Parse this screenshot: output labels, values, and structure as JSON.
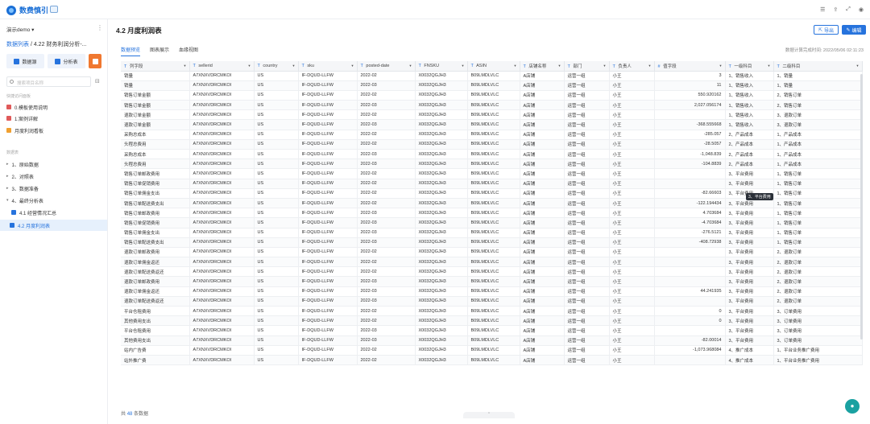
{
  "app": {
    "logo_text": "数费慎引"
  },
  "topbar": {
    "icons": [
      "list-icon",
      "share-icon",
      "expand-icon",
      "user-icon"
    ]
  },
  "sidebar": {
    "workspace": "演示demo",
    "breadcrumb_link": "数据列表",
    "breadcrumb_rest": " / 4.22 财务利润分析-...",
    "buttons": [
      {
        "label": "数据源"
      },
      {
        "label": "分析表"
      }
    ],
    "search_placeholder": "搜索项目名称",
    "section_recent": "快捷访问面板",
    "recent": [
      {
        "label": "0.模板使用说明"
      },
      {
        "label": "1.案例详解"
      },
      {
        "label": "月度利润看板"
      }
    ],
    "section_tables": "数据表",
    "folders": [
      {
        "label": "1、原始数据"
      },
      {
        "label": "2、对照表"
      },
      {
        "label": "3、数据准备"
      },
      {
        "label": "4、最终分析表"
      }
    ],
    "subitems": [
      {
        "label": "4.1 经营情况汇总"
      },
      {
        "label": "4.2 月度利润表"
      }
    ]
  },
  "main": {
    "title": "4.2 月度利润表",
    "export_label": "导出",
    "edit_label": "编辑",
    "tabs": [
      "数据预览",
      "图表展示",
      "血缘视图"
    ],
    "calc_time": "数据计算完成时间: 2022/05/06 02:11:23",
    "tooltip": "3、平台费用",
    "footer_prefix": "共",
    "footer_count": "48",
    "footer_suffix": "条数据"
  },
  "table": {
    "columns": [
      "列字段",
      "sellerid",
      "country",
      "sku",
      "posted-date",
      "FNSKU",
      "ASIN",
      "店铺名称",
      "部门",
      "负责人",
      "值字段",
      "一级科目",
      "二级科目"
    ],
    "rows": [
      [
        "销量",
        "A7XNXVDRCMKOI",
        "US",
        "IF-DQUD-LLFW",
        "2022-02",
        "X0032QGJH3",
        "B09LMDLVLC",
        "A店铺",
        "运营一组",
        "小王",
        "3",
        "1、销售收入",
        "1、销量"
      ],
      [
        "销量",
        "A7XNXVDRCMKOI",
        "US",
        "IF-DQUD-LLFW",
        "2022-03",
        "X0032QGJH3",
        "B09LMDLVLC",
        "A店铺",
        "运营一组",
        "小王",
        "11",
        "1、销售收入",
        "1、销量"
      ],
      [
        "销售订单金额",
        "A7XNXVDRCMKOI",
        "US",
        "IF-DQUD-LLFW",
        "2022-02",
        "X0032QGJH3",
        "B09LMDLVLC",
        "A店铺",
        "运营一组",
        "小王",
        "550.920162",
        "1、销售收入",
        "2、销售订单"
      ],
      [
        "销售订单金额",
        "A7XNXVDRCMKOI",
        "US",
        "IF-DQUD-LLFW",
        "2022-03",
        "X0032QGJH3",
        "B09LMDLVLC",
        "A店铺",
        "运营一组",
        "小王",
        "2,027.056174",
        "1、销售收入",
        "2、销售订单"
      ],
      [
        "退款订单金额",
        "A7XNXVDRCMKOI",
        "US",
        "IF-DQUD-LLFW",
        "2022-02",
        "X0032QGJH3",
        "B09LMDLVLC",
        "A店铺",
        "运营一组",
        "小王",
        "",
        "1、销售收入",
        "3、退款订单"
      ],
      [
        "退款订单金额",
        "A7XNXVDRCMKOI",
        "US",
        "IF-DQUD-LLFW",
        "2022-03",
        "X0032QGJH3",
        "B09LMDLVLC",
        "A店铺",
        "运营一组",
        "小王",
        "-368.555668",
        "1、销售收入",
        "3、退款订单"
      ],
      [
        "采购总成本",
        "A7XNXVDRCMKOI",
        "US",
        "IF-DQUD-LLFW",
        "2022-02",
        "X0032QGJH3",
        "B09LMDLVLC",
        "A店铺",
        "运营一组",
        "小王",
        "-285.057",
        "2、产品成本",
        "1、产品成本"
      ],
      [
        "头程总费用",
        "A7XNXVDRCMKOI",
        "US",
        "IF-DQUD-LLFW",
        "2022-02",
        "X0032QGJH3",
        "B09LMDLVLC",
        "A店铺",
        "运营一组",
        "小王",
        "-28.5057",
        "2、产品成本",
        "1、产品成本"
      ],
      [
        "采购总成本",
        "A7XNXVDRCMKOI",
        "US",
        "IF-DQUD-LLFW",
        "2022-03",
        "X0032QGJH3",
        "B09LMDLVLC",
        "A店铺",
        "运营一组",
        "小王",
        "-1,048.839",
        "2、产品成本",
        "1、产品成本"
      ],
      [
        "头程总费用",
        "A7XNXVDRCMKOI",
        "US",
        "IF-DQUD-LLFW",
        "2022-03",
        "X0032QGJH3",
        "B09LMDLVLC",
        "A店铺",
        "运营一组",
        "小王",
        "-104.8839",
        "2、产品成本",
        "1、产品成本"
      ],
      [
        "销售订单邮政费用",
        "A7XNXVDRCMKOI",
        "US",
        "IF-DQUD-LLFW",
        "2022-02",
        "X0032QGJH3",
        "B09LMDLVLC",
        "A店铺",
        "运营一组",
        "小王",
        "",
        "3、平台费用",
        "1、销售订单"
      ],
      [
        "销售订单促销费用",
        "A7XNXVDRCMKOI",
        "US",
        "IF-DQUD-LLFW",
        "2022-02",
        "X0032QGJH3",
        "B09LMDLVLC",
        "A店铺",
        "运营一组",
        "小王",
        "",
        "3、平台费用",
        "1、销售订单"
      ],
      [
        "销售订单佣金支出",
        "A7XNXVDRCMKOI",
        "US",
        "IF-DQUD-LLFW",
        "2022-02",
        "X0032QGJH3",
        "B09LMDLVLC",
        "A店铺",
        "运营一组",
        "小王",
        "-82.66603",
        "3、平台费用",
        "1、销售订单"
      ],
      [
        "销售订单配送费支出",
        "A7XNXVDRCMKOI",
        "US",
        "IF-DQUD-LLFW",
        "2022-02",
        "X0032QGJH3",
        "B09LMDLVLC",
        "A店铺",
        "运营一组",
        "小王",
        "-122.194434",
        "3、平台费用",
        "1、销售订单"
      ],
      [
        "销售订单邮政费用",
        "A7XNXVDRCMKOI",
        "US",
        "IF-DQUD-LLFW",
        "2022-03",
        "X0032QGJH3",
        "B09LMDLVLC",
        "A店铺",
        "运营一组",
        "小王",
        "4.703684",
        "3、平台费用",
        "1、销售订单"
      ],
      [
        "销售订单促销费用",
        "A7XNXVDRCMKOI",
        "US",
        "IF-DQUD-LLFW",
        "2022-03",
        "X0032QGJH3",
        "B09LMDLVLC",
        "A店铺",
        "运营一组",
        "小王",
        "-4.703684",
        "3、平台费用",
        "1、销售订单"
      ],
      [
        "销售订单佣金支出",
        "A7XNXVDRCMKOI",
        "US",
        "IF-DQUD-LLFW",
        "2022-03",
        "X0032QGJH3",
        "B09LMDLVLC",
        "A店铺",
        "运营一组",
        "小王",
        "-276.5121",
        "3、平台费用",
        "1、销售订单"
      ],
      [
        "销售订单配送费支出",
        "A7XNXVDRCMKOI",
        "US",
        "IF-DQUD-LLFW",
        "2022-03",
        "X0032QGJH3",
        "B09LMDLVLC",
        "A店铺",
        "运营一组",
        "小王",
        "-408.72938",
        "3、平台费用",
        "1、销售订单"
      ],
      [
        "退款订单邮政费用",
        "A7XNXVDRCMKOI",
        "US",
        "IF-DQUD-LLFW",
        "2022-02",
        "X0032QGJH3",
        "B09LMDLVLC",
        "A店铺",
        "运营一组",
        "小王",
        "",
        "3、平台费用",
        "2、退款订单"
      ],
      [
        "退款订单佣金返还",
        "A7XNXVDRCMKOI",
        "US",
        "IF-DQUD-LLFW",
        "2022-02",
        "X0032QGJH3",
        "B09LMDLVLC",
        "A店铺",
        "运营一组",
        "小王",
        "",
        "3、平台费用",
        "2、退款订单"
      ],
      [
        "退款订单配送费返还",
        "A7XNXVDRCMKOI",
        "US",
        "IF-DQUD-LLFW",
        "2022-02",
        "X0032QGJH3",
        "B09LMDLVLC",
        "A店铺",
        "运营一组",
        "小王",
        "",
        "3、平台费用",
        "2、退款订单"
      ],
      [
        "退款订单邮政费用",
        "A7XNXVDRCMKOI",
        "US",
        "IF-DQUD-LLFW",
        "2022-03",
        "X0032QGJH3",
        "B09LMDLVLC",
        "A店铺",
        "运营一组",
        "小王",
        "",
        "3、平台费用",
        "2、退款订单"
      ],
      [
        "退款订单佣金返还",
        "A7XNXVDRCMKOI",
        "US",
        "IF-DQUD-LLFW",
        "2022-03",
        "X0032QGJH3",
        "B09LMDLVLC",
        "A店铺",
        "运营一组",
        "小王",
        "44.241935",
        "3、平台费用",
        "2、退款订单"
      ],
      [
        "退款订单配送费返还",
        "A7XNXVDRCMKOI",
        "US",
        "IF-DQUD-LLFW",
        "2022-03",
        "X0032QGJH3",
        "B09LMDLVLC",
        "A店铺",
        "运营一组",
        "小王",
        "",
        "3、平台费用",
        "2、退款订单"
      ],
      [
        "平台仓租费用",
        "A7XNXVDRCMKOI",
        "US",
        "IF-DQUD-LLFW",
        "2022-02",
        "X0032QGJH3",
        "B09LMDLVLC",
        "A店铺",
        "运营一组",
        "小王",
        "0",
        "3、平台费用",
        "3、订单费用"
      ],
      [
        "其他费用支出",
        "A7XNXVDRCMKOI",
        "US",
        "IF-DQUD-LLFW",
        "2022-02",
        "X0032QGJH3",
        "B09LMDLVLC",
        "A店铺",
        "运营一组",
        "小王",
        "0",
        "3、平台费用",
        "3、订单费用"
      ],
      [
        "平台仓租费用",
        "A7XNXVDRCMKOI",
        "US",
        "IF-DQUD-LLFW",
        "2022-03",
        "X0032QGJH3",
        "B09LMDLVLC",
        "A店铺",
        "运营一组",
        "小王",
        "",
        "3、平台费用",
        "3、订单费用"
      ],
      [
        "其他费用支出",
        "A7XNXVDRCMKOI",
        "US",
        "IF-DQUD-LLFW",
        "2022-03",
        "X0032QGJH3",
        "B09LMDLVLC",
        "A店铺",
        "运营一组",
        "小王",
        "-82.00014",
        "3、平台费用",
        "3、订单费用"
      ],
      [
        "站内广告费",
        "A7XNXVDRCMKOI",
        "US",
        "IF-DQUD-LLFW",
        "2022-02",
        "X0032QGJH3",
        "B09LMDLVLC",
        "A店铺",
        "运营一组",
        "小王",
        "-1,073.968084",
        "4、推广成本",
        "1、平台业务推广费用"
      ],
      [
        "站外推广费",
        "A7XNXVDRCMKOI",
        "US",
        "IF-DQUD-LLFW",
        "2022-02",
        "X0032QGJH3",
        "B09LMDLVLC",
        "A店铺",
        "运营一组",
        "小王",
        "",
        "4、推广成本",
        "1、平台业务推广费用"
      ]
    ]
  },
  "colors": {
    "accent": "#2673dd",
    "fab": "#1aa1a1",
    "orange": "#f07830"
  }
}
